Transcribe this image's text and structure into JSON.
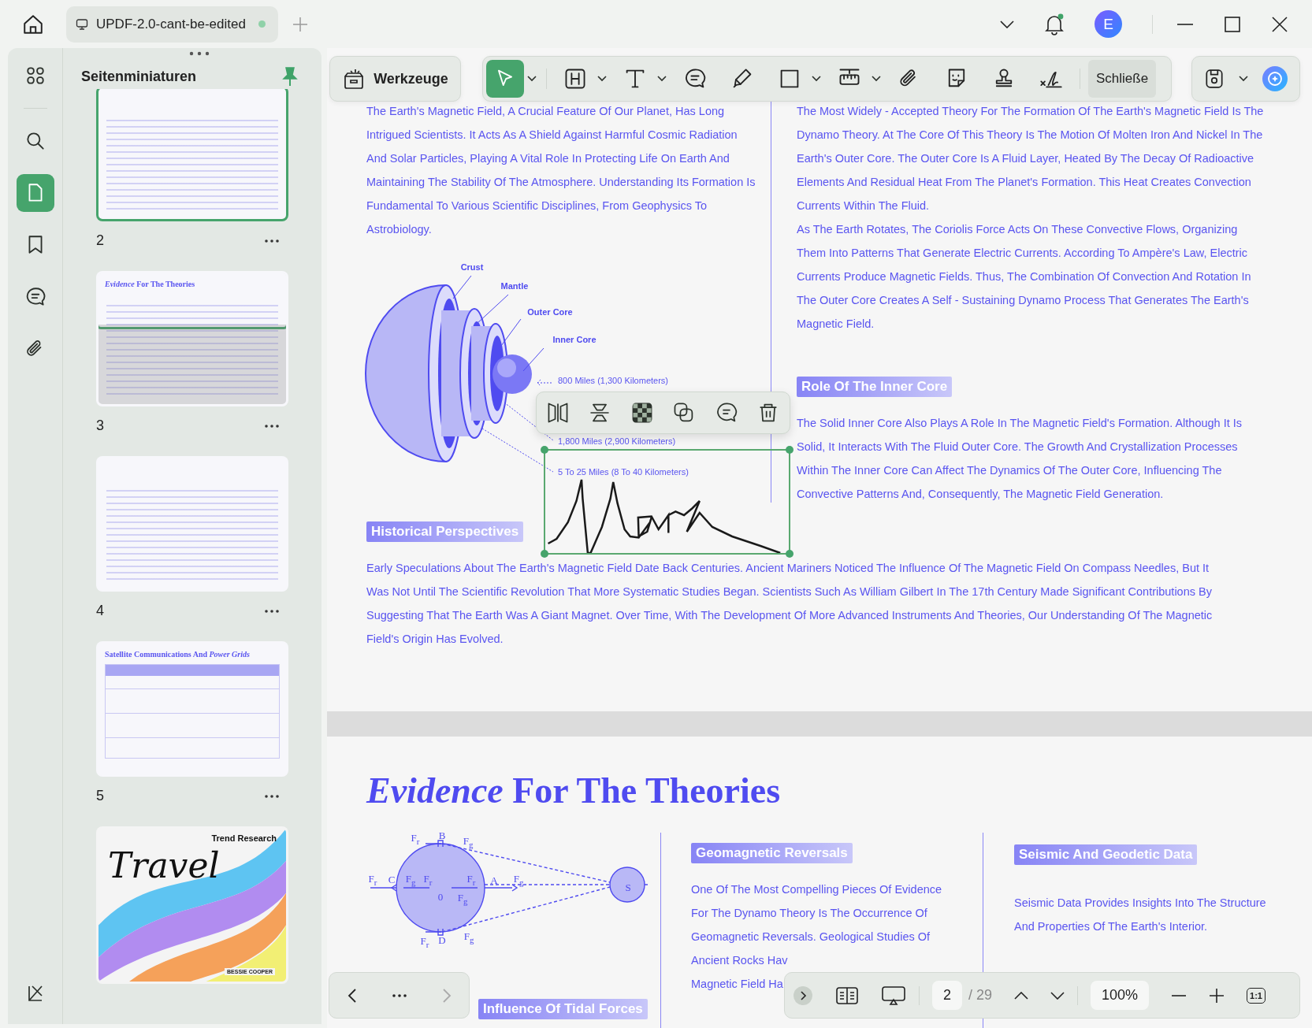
{
  "title_bar": {
    "tab": {
      "title": "UPDF-2.0-cant-be-edited",
      "unsaved": true
    },
    "notifications": true,
    "avatar": "E"
  },
  "rail": [
    {
      "kind": "thumbnails",
      "selected": false
    },
    {
      "kind": "search",
      "selected": false
    },
    {
      "kind": "pages",
      "selected": true
    },
    {
      "kind": "bookmarks",
      "selected": false
    },
    {
      "kind": "comments",
      "selected": false
    },
    {
      "kind": "attachments",
      "selected": false
    }
  ],
  "sidebar": {
    "title": "Seitenminiaturen",
    "pinned": true,
    "thumbnails": [
      {
        "kind": "article",
        "page": "2",
        "selected": true,
        "viewport": false
      },
      {
        "kind": "article",
        "page": "3",
        "selected": false,
        "viewport": true,
        "heading": "*Evidence* For The Theories"
      },
      {
        "kind": "article",
        "page": "4",
        "selected": false,
        "viewport": false
      },
      {
        "kind": "table",
        "page": "5",
        "selected": false,
        "viewport": false,
        "heading": "Satellite Communications And *Power Grids*"
      },
      {
        "kind": "cover",
        "selected": false,
        "viewport": false,
        "title": "Travel",
        "subtitle": "Trend Research",
        "author": "BESSIE COOPER"
      }
    ]
  },
  "toolbar": {
    "tools_button": "Werkzeuge",
    "tools": [
      {
        "kind": "select",
        "selected": true,
        "menu": true
      },
      {
        "kind": "heading",
        "selected": false,
        "menu": true
      },
      {
        "kind": "text",
        "selected": false,
        "menu": true
      },
      {
        "kind": "comment",
        "selected": false,
        "menu": false
      },
      {
        "kind": "pencil",
        "selected": false,
        "menu": false
      },
      {
        "kind": "rectangle",
        "selected": false,
        "menu": true
      },
      {
        "kind": "ruler",
        "selected": false,
        "menu": true
      },
      {
        "kind": "attach",
        "selected": false,
        "menu": false
      },
      {
        "kind": "sticker",
        "selected": false,
        "menu": false
      },
      {
        "kind": "stamp",
        "selected": false,
        "menu": false
      },
      {
        "kind": "signature",
        "selected": false,
        "menu": false
      }
    ],
    "close_button": "Schließe",
    "save_menu": true
  },
  "page_1": {
    "intro": "The Earth's Magnetic Field, A Crucial Feature Of Our Planet, Has Long Intrigued Scientists. It Acts As A Shield Against Harmful Cosmic Radiation And Solar Particles, Playing A Vital Role In Protecting Life On Earth And Maintaining The Stability Of The Atmosphere. Understanding Its Formation Is Fundamental To Various Scientific Disciplines, From Geophysics To Astrobiology.",
    "earth_diagram": {
      "layers": [
        "Crust",
        "Mantle",
        "Outer Core",
        "Inner Core"
      ],
      "measurements": [
        "800 Miles (1,300 Kilometers)",
        "1,800 Miles (2,900 Kilometers)",
        "5 To 25 Miles (8 To 40 Kilometers)"
      ]
    },
    "theory": [
      "The Most Widely - Accepted Theory For The Formation Of The Earth's Magnetic Field Is The Dynamo Theory. At The Core Of This Theory Is The Motion Of Molten Iron And Nickel In The Earth's Outer Core. The Outer Core Is A Fluid Layer, Heated By The Decay Of Radioactive Elements And Residual Heat From The Planet's Formation. This Heat Creates Convection Currents Within The Fluid.",
      "As The Earth Rotates, The Coriolis Force Acts On These Convective Flows, Organizing Them Into Patterns That Generate Electric Currents. According To Ampère's Law, Electric Currents Produce Magnetic Fields. Thus, The Combination Of Convection And Rotation In The Outer Core Creates A Self - Sustaining Dynamo Process That Generates The Earth's Magnetic Field."
    ],
    "inner_core_heading": "Role Of The Inner Core",
    "inner_core": "The Solid Inner Core Also Plays A Role In The Magnetic Field's Formation. Although It Is Solid, It Interacts With The Fluid Outer Core. The Growth And Crystallization Processes Within The Inner Core Can Affect The Dynamics Of The Outer Core, Influencing The Convective Patterns And, Consequently, The Magnetic Field Generation.",
    "history_heading": "Historical Perspectives",
    "history": "Early Speculations About The Earth's Magnetic Field Date Back Centuries. Ancient Mariners Noticed The Influence Of The Magnetic Field On Compass Needles, But It Was Not Until The Scientific Revolution That More Systematic Studies Began. Scientists Such As William Gilbert In The 17th Century Made Significant Contributions By Suggesting That The Earth Was A Giant Magnet. Over Time, With The Development Of More Advanced Instruments And Theories, Our Understanding Of The Magnetic Field's Origin Has Evolved.",
    "signature": {
      "selected": true
    },
    "annotation_actions": [
      {
        "kind": "flip-horizontal"
      },
      {
        "kind": "flip-vertical"
      },
      {
        "kind": "opacity"
      },
      {
        "kind": "copy"
      },
      {
        "kind": "comment"
      },
      {
        "kind": "delete"
      }
    ]
  },
  "page_2": {
    "title": "*Evidence* For The Theories",
    "force_diagram": {
      "labels": [
        "F$_{r}$",
        "B",
        "F$_{g}$",
        "F$_{r}$",
        "C",
        "F$_{g}$",
        "F$_{r}$",
        "F$_{r}$",
        "A",
        "F$_{g}$",
        "0",
        "F$_{g}$",
        "S",
        "F$_{r}$",
        "D",
        "F$_{g}$"
      ]
    },
    "tidal_heading": "Influence Of Tidal Forces",
    "reversals_heading": "Geomagnetic Reversals",
    "reversals_lines": [
      "One Of The Most Compelling Pieces Of Evidence",
      "For The Dynamo Theory Is The Occurrence Of",
      "Geomagnetic Reversals. Geological Studies Of",
      "Ancient Rocks Hav",
      "Magnetic Field Ha"
    ],
    "seismic_heading": "Seismic And Geodetic Data",
    "seismic": "Seismic Data Provides Insights Into The Structure And Properties Of The Earth's Interior."
  },
  "navigation": {
    "previous_enabled": true,
    "next_enabled": false,
    "page": "2",
    "total": "/ 29",
    "zoom": "100%",
    "actual_size": "1:1"
  }
}
